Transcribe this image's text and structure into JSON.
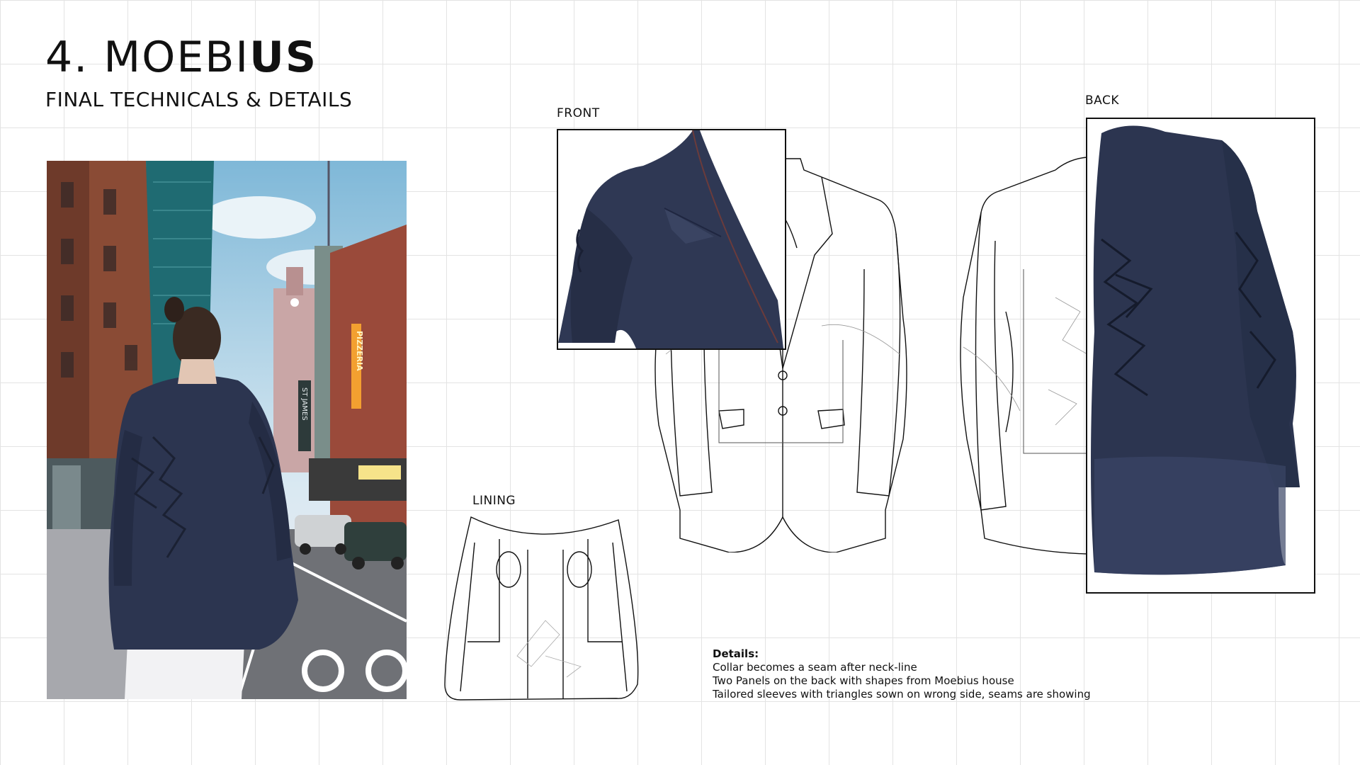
{
  "header": {
    "title_number": "4.",
    "title_light": "MOEBI",
    "title_heavy": "US",
    "subtitle": "FINAL TECHNICALS & DETAILS"
  },
  "labels": {
    "front": "FRONT",
    "back": "BACK",
    "lining": "LINING"
  },
  "details": {
    "heading": "Details:",
    "lines": [
      "Collar becomes a seam after neck-line",
      "Two Panels on the back with shapes from Moebius house",
      "Tailored sleeves with triangles sown on wrong side, seams are showing"
    ]
  },
  "street_signs": {
    "pizzeria": "PIZZERIA",
    "street": "ST JAMES"
  },
  "colors": {
    "jacket_navy": "#2c3550",
    "grid": "#e3e3e3",
    "line": "#111111"
  }
}
